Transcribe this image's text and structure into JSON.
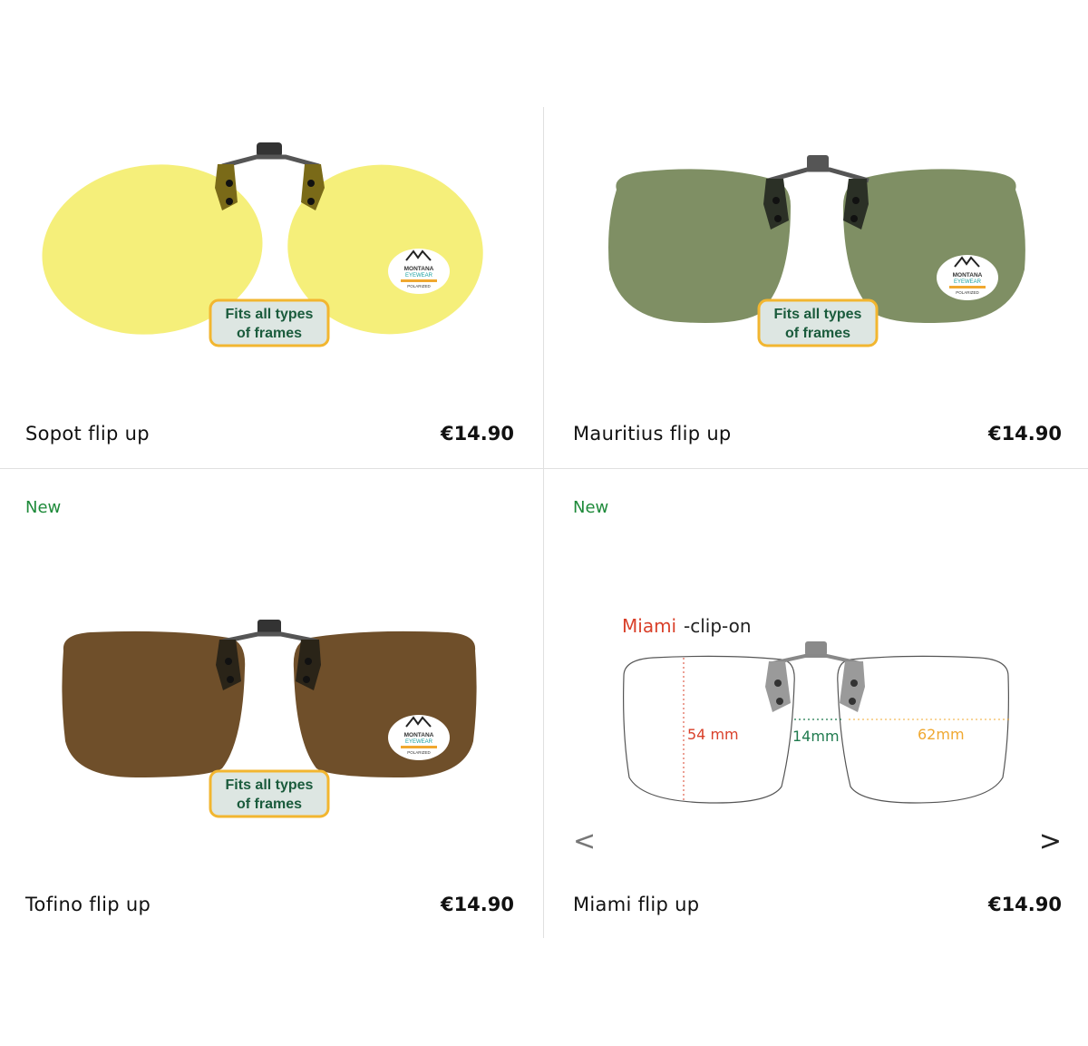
{
  "colors": {
    "new_badge": "#1e8a3a",
    "lens_yellow": "#f5ef7a",
    "lens_green": "#7f8f64",
    "lens_brown": "#6f4f2a",
    "frames_badge_bg": "#dde6e2",
    "frames_badge_border": "#f2b630",
    "frames_badge_text": "#1a5b3c",
    "dim_red": "#d9402a",
    "dim_green": "#1f7a4e",
    "dim_orange": "#f0a830"
  },
  "logo": {
    "brand_line1": "MONTANA",
    "brand_line2": "EYEWEAR",
    "tagline": "POLARIZED"
  },
  "products": [
    {
      "name": "Sopot flip up",
      "price": "€14.90",
      "badge_line1": "Fits all types",
      "badge_line2": "of frames",
      "lens_color": "yellow",
      "is_new": false
    },
    {
      "name": "Mauritius flip up",
      "price": "€14.90",
      "badge_line1": "Fits all types",
      "badge_line2": "of frames",
      "lens_color": "green",
      "is_new": false
    },
    {
      "name": "Tofino flip up",
      "price": "€14.90",
      "badge_line1": "Fits all types",
      "badge_line2": "of frames",
      "lens_color": "brown",
      "is_new": true,
      "new_label": "New"
    },
    {
      "name": "Miami flip up",
      "price": "€14.90",
      "is_new": true,
      "new_label": "New",
      "diagram": {
        "title_highlight": "Miami",
        "title_rest": " -clip-on",
        "height_label": "54 mm",
        "bridge_label": "14mm",
        "width_label": "62mm"
      },
      "carousel": {
        "prev_glyph": "<",
        "next_glyph": ">"
      }
    }
  ]
}
